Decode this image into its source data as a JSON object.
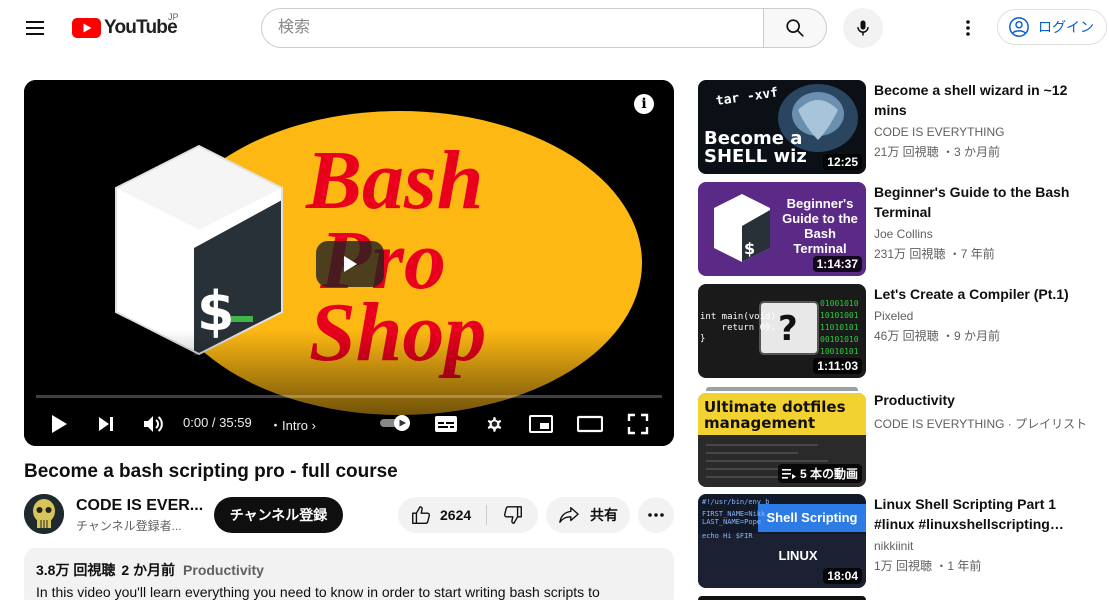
{
  "header": {
    "logo_text": "YouTube",
    "country_code": "JP",
    "search_placeholder": "検索",
    "login_label": "ログイン"
  },
  "player": {
    "thumbnail_text": [
      "Bash",
      "Pro",
      "Shop"
    ],
    "time": "0:00 / 35:59",
    "chapter": "Intro",
    "progress_fraction": 0.0
  },
  "video": {
    "title": "Become a bash scripting pro - full course",
    "channel_name": "CODE IS EVER...",
    "channel_subs": "チャンネル登録者...",
    "subscribe_label": "チャンネル登録",
    "like_count": "2624",
    "share_label": "共有",
    "views": "3.8万 回視聴",
    "published": "2 か月前",
    "category": "Productivity",
    "description": "In this video you'll learn everything you need to know in order to start writing bash scripts to"
  },
  "recommendations": [
    {
      "title": "Become a shell wizard in ~12 mins",
      "channel": "CODE IS EVERYTHING",
      "meta": "21万 回視聴 ・3 か月前",
      "duration": "12:25",
      "thumb_text": "Become a SHELL wiz",
      "thumb_overlay": "tar -xvf"
    },
    {
      "title": "Beginner's Guide to the Bash Terminal",
      "channel": "Joe Collins",
      "meta": "231万 回視聴 ・7 年前",
      "duration": "1:14:37",
      "thumb_text": "Beginner's Guide to the Bash Terminal"
    },
    {
      "title": "Let's Create a Compiler (Pt.1)",
      "channel": "Pixeled",
      "meta": "46万 回視聴 ・9 か月前",
      "duration": "1:11:03",
      "thumb_code": [
        "int main(void)",
        "    return 69;",
        "}"
      ]
    },
    {
      "title": "Productivity",
      "channel": "CODE IS EVERYTHING · プレイリスト",
      "meta": "",
      "duration": "5 本の動画",
      "thumb_text": "Ultimate dotfiles management"
    },
    {
      "title": "Linux Shell Scripting Part 1 #linux #linuxshellscripting…",
      "channel": "nikkiinit",
      "meta": "1万 回視聴 ・1 年前",
      "duration": "18:04",
      "thumb_text": "Shell Scripting",
      "thumb_sub": "LINUX"
    }
  ],
  "colors": {
    "yt_red": "#ff0000",
    "link_blue": "#065fd4",
    "bash_yellow": "#fdb813",
    "bash_red": "#e8001c"
  }
}
